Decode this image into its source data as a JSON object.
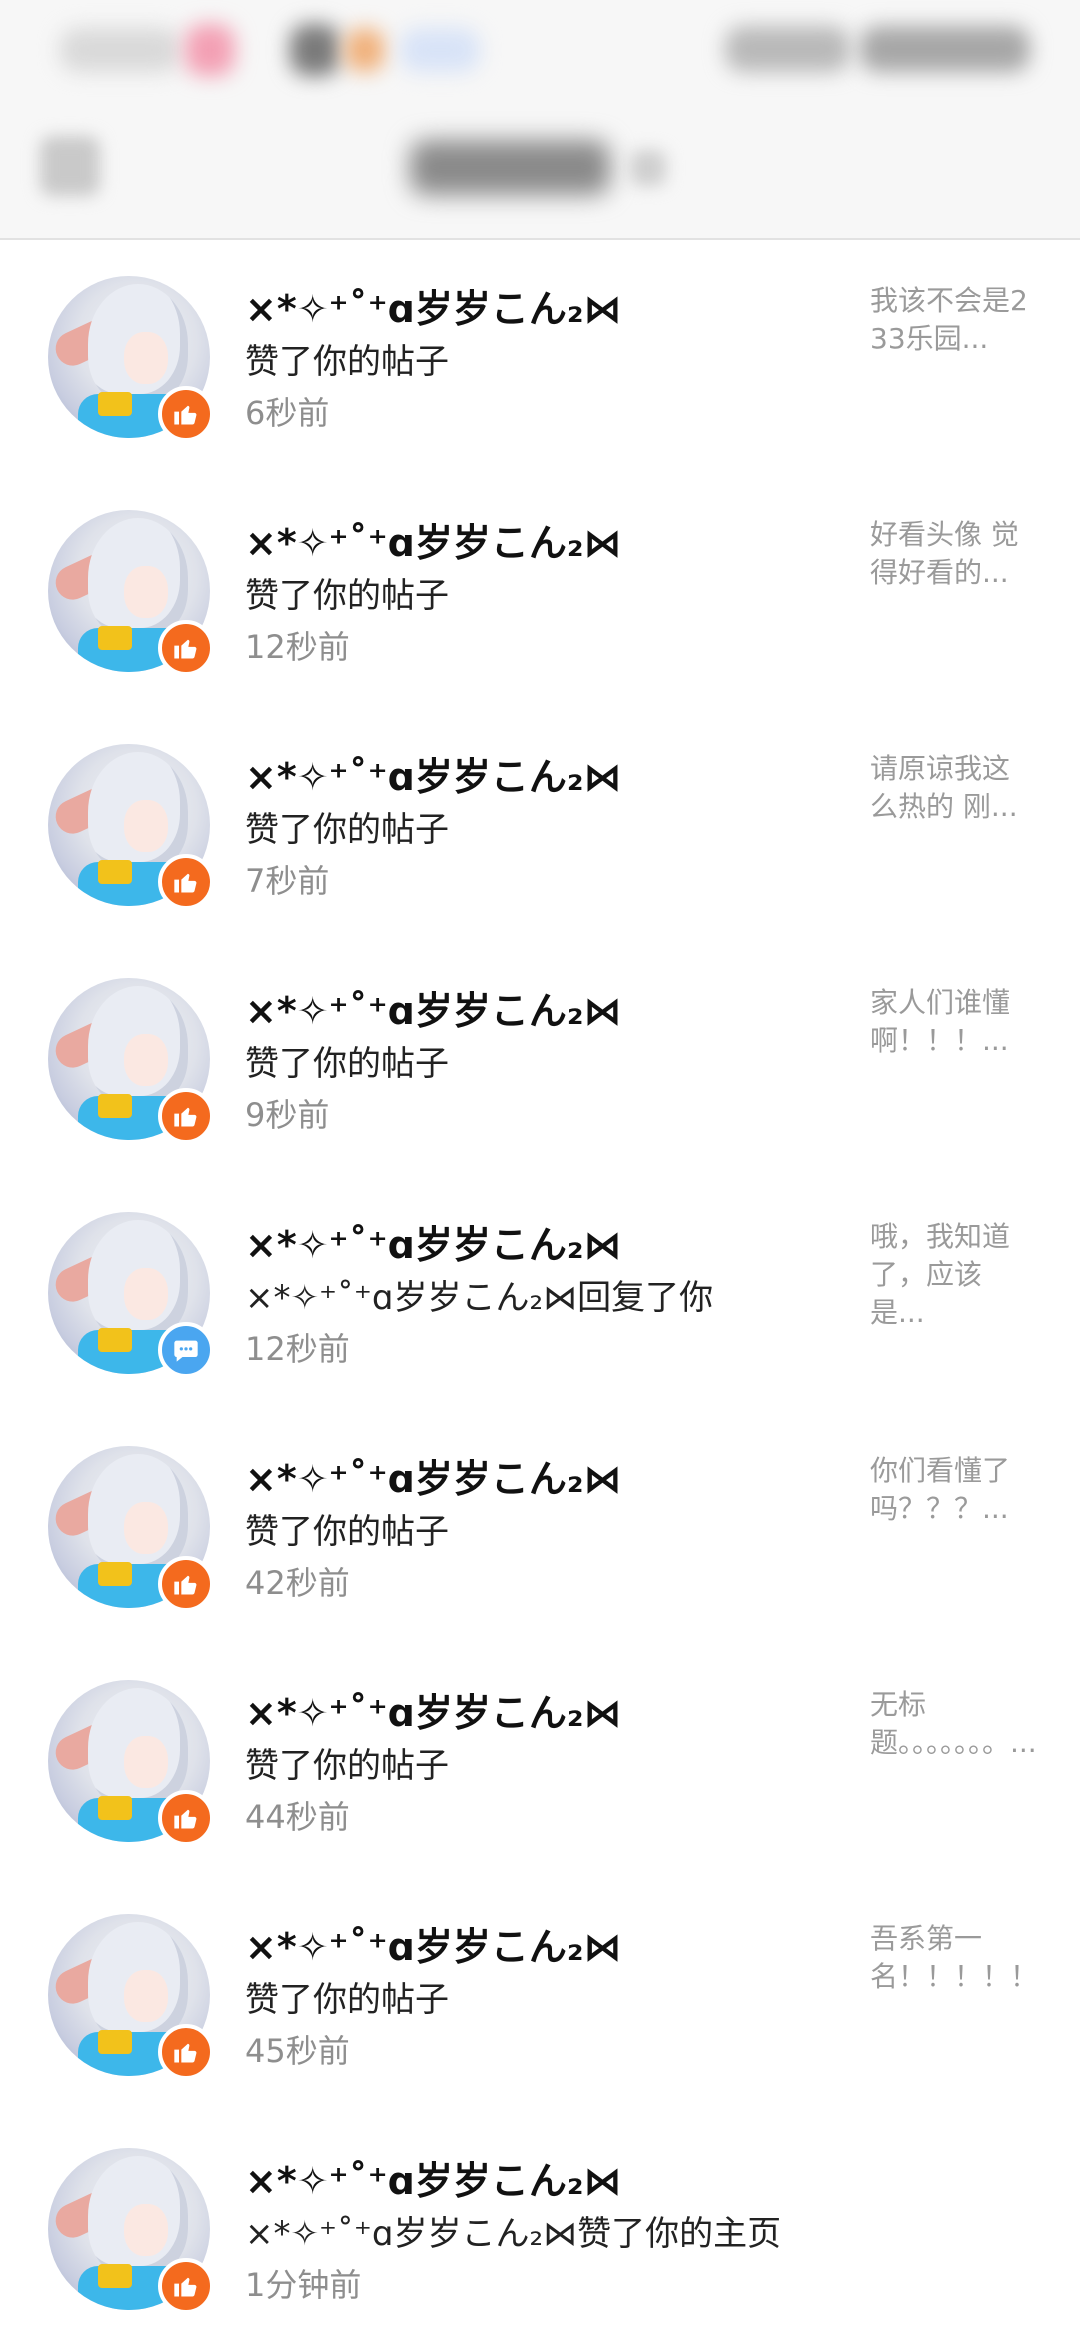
{
  "notifications": [
    {
      "name": "×*✧⁺˚⁺ɑ岁岁こん₂⋈",
      "action": "赞了你的帖子",
      "time": "6秒前",
      "badge": "like-icon",
      "preview": "我该不会是233乐园..."
    },
    {
      "name": "×*✧⁺˚⁺ɑ岁岁こん₂⋈",
      "action": "赞了你的帖子",
      "time": "12秒前",
      "badge": "like-icon",
      "preview": "好看头像 觉得好看的..."
    },
    {
      "name": "×*✧⁺˚⁺ɑ岁岁こん₂⋈",
      "action": "赞了你的帖子",
      "time": "7秒前",
      "badge": "like-icon",
      "preview": "请原谅我这么热的 刚..."
    },
    {
      "name": "×*✧⁺˚⁺ɑ岁岁こん₂⋈",
      "action": "赞了你的帖子",
      "time": "9秒前",
      "badge": "like-icon",
      "preview": "家人们谁懂啊！！！..."
    },
    {
      "name": "×*✧⁺˚⁺ɑ岁岁こん₂⋈",
      "action": "×*✧⁺˚⁺ɑ岁岁こん₂⋈回复了你",
      "time": "12秒前",
      "badge": "comment-icon",
      "preview": "哦，我知道了，应该是..."
    },
    {
      "name": "×*✧⁺˚⁺ɑ岁岁こん₂⋈",
      "action": "赞了你的帖子",
      "time": "42秒前",
      "badge": "like-icon",
      "preview": "你们看懂了吗？？？..."
    },
    {
      "name": "×*✧⁺˚⁺ɑ岁岁こん₂⋈",
      "action": "赞了你的帖子",
      "time": "44秒前",
      "badge": "like-icon",
      "preview": "无标题。。。。。。。..."
    },
    {
      "name": "×*✧⁺˚⁺ɑ岁岁こん₂⋈",
      "action": "赞了你的帖子",
      "time": "45秒前",
      "badge": "like-icon",
      "preview": "吾系第一名！！！！！..."
    },
    {
      "name": "×*✧⁺˚⁺ɑ岁岁こん₂⋈",
      "action": "×*✧⁺˚⁺ɑ岁岁こん₂⋈赞了你的主页",
      "time": "1分钟前",
      "badge": "like-icon",
      "preview": ""
    }
  ],
  "colors": {
    "like_badge": "#f46a1e",
    "comment_badge": "#4aa6f0",
    "time_text": "#8e8e8e",
    "preview_text": "#9a9a9a"
  }
}
